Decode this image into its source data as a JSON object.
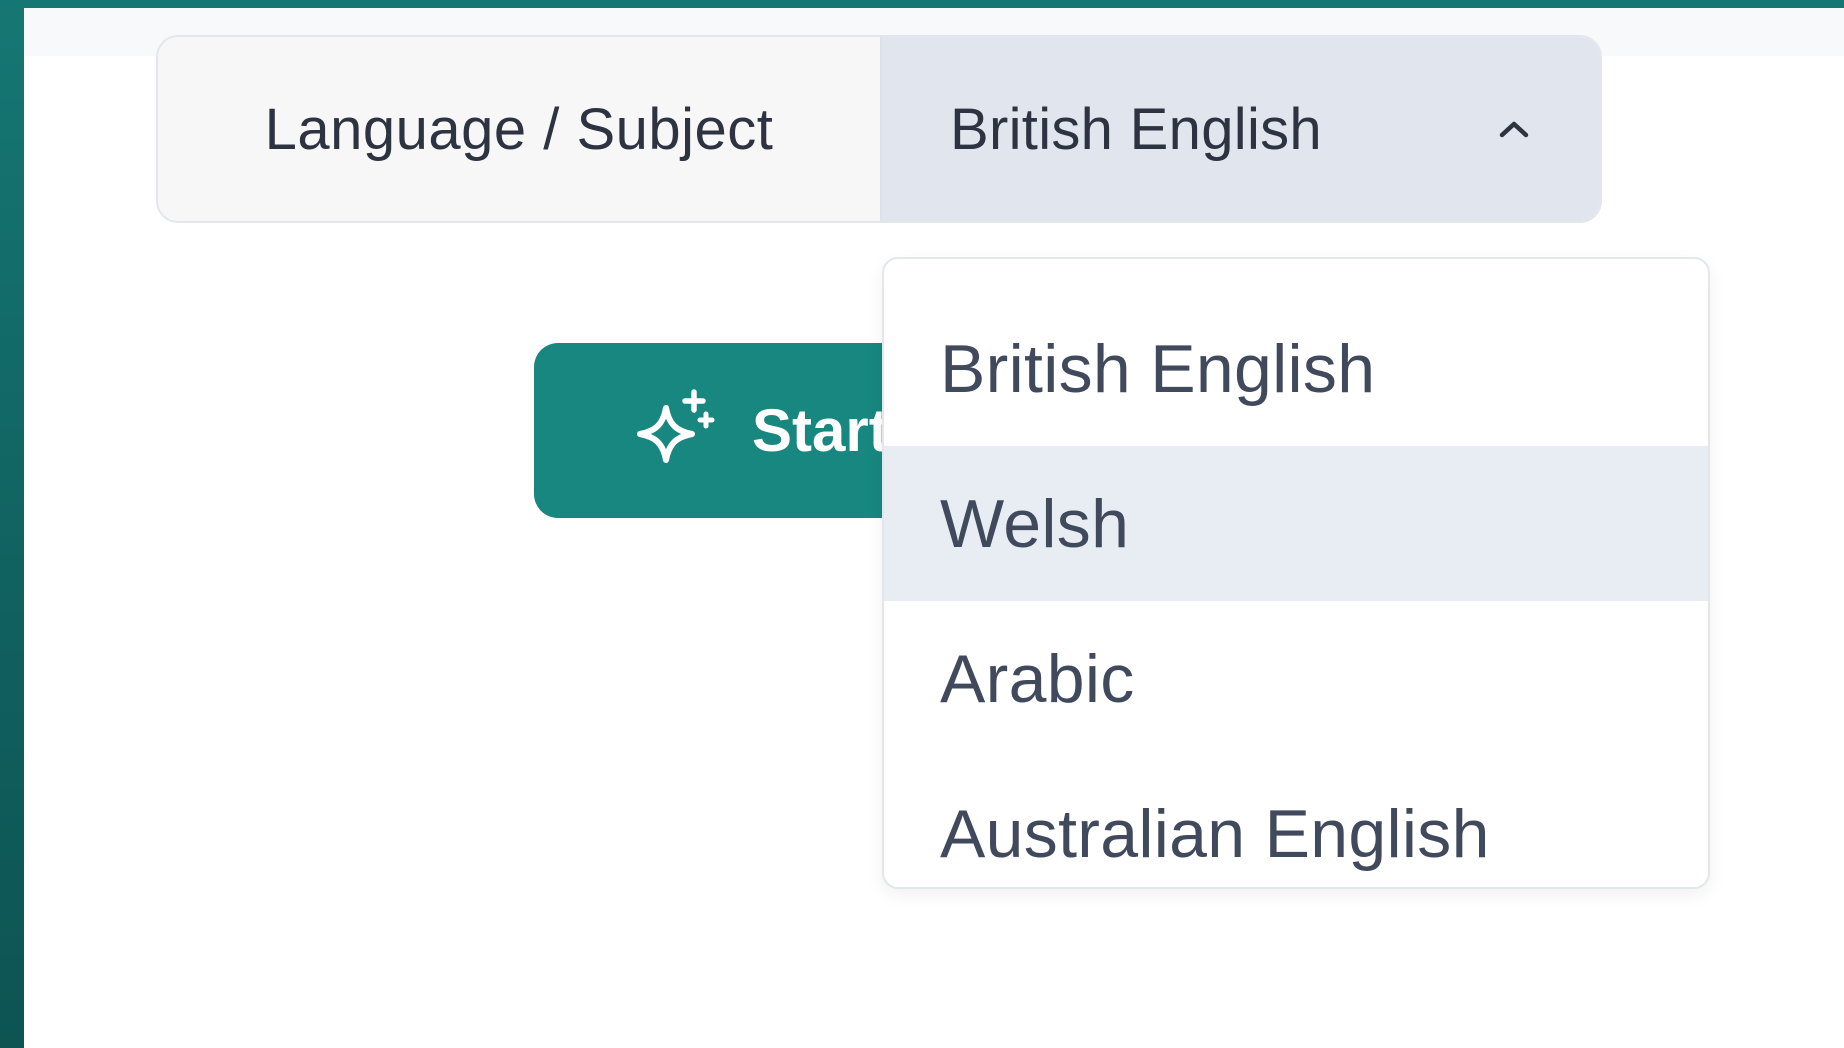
{
  "language_subject": {
    "label": "Language / Subject",
    "selected_value": "British English",
    "chevron_icon": "chevron-up-icon"
  },
  "start_button": {
    "label": "Start",
    "icon": "sparkle-icon"
  },
  "dropdown": {
    "highlighted_item": "Welsh",
    "options": [
      {
        "label": "British English"
      },
      {
        "label": "Welsh"
      },
      {
        "label": "Arabic"
      },
      {
        "label": "Australian English"
      }
    ]
  },
  "colors": {
    "accent": "#17877f",
    "frame": "#157773",
    "select_bg": "#e1e6ee",
    "highlight_bg": "#e8edf3"
  }
}
